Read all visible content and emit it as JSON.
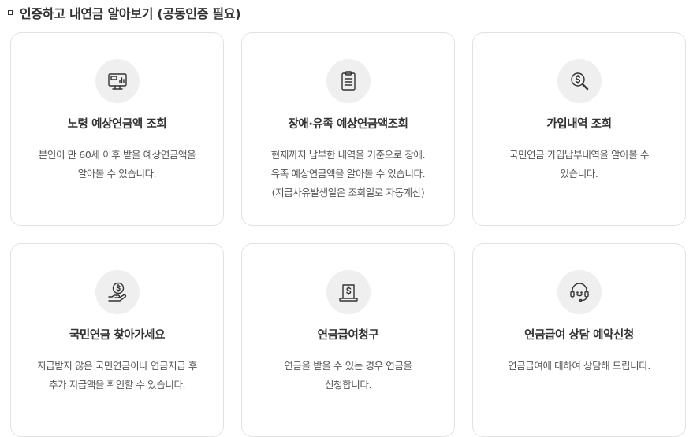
{
  "section": {
    "title": "인증하고 내연금 알아보기 (공동인증 필요)"
  },
  "cards": [
    {
      "title": "노령 예상연금액 조회",
      "desc": "본인이 만 60세 이후 받을 예상연금액을\n알아볼 수 있습니다.",
      "icon": "monitor-chart-icon"
    },
    {
      "title": "장애·유족 예상연금액조회",
      "desc": "현재까지 납부한 내역을 기준으로 장애.\n유족 예상연금액을 알아볼 수 있습니다.\n(지급사유발생일은 조회일로 자동계산)",
      "icon": "clipboard-list-icon"
    },
    {
      "title": "가입내역 조회",
      "desc": "국민연금 가입납부내역을 알아볼 수\n있습니다.",
      "icon": "dollar-magnifier-icon"
    },
    {
      "title": "국민연금 찾아가세요",
      "desc": "지급받지 않은 국민연금이나 연금지급 후\n추가 지급액을 확인할 수 있습니다.",
      "icon": "hand-coin-icon"
    },
    {
      "title": "연금급여청구",
      "desc": "연금을 받을 수 있는 경우 연금을\n신청합니다.",
      "icon": "dollar-document-icon"
    },
    {
      "title": "연금급여 상담 예약신청",
      "desc": "연금급여에 대하여 상담해 드립니다.",
      "icon": "headset-smile-icon"
    }
  ]
}
